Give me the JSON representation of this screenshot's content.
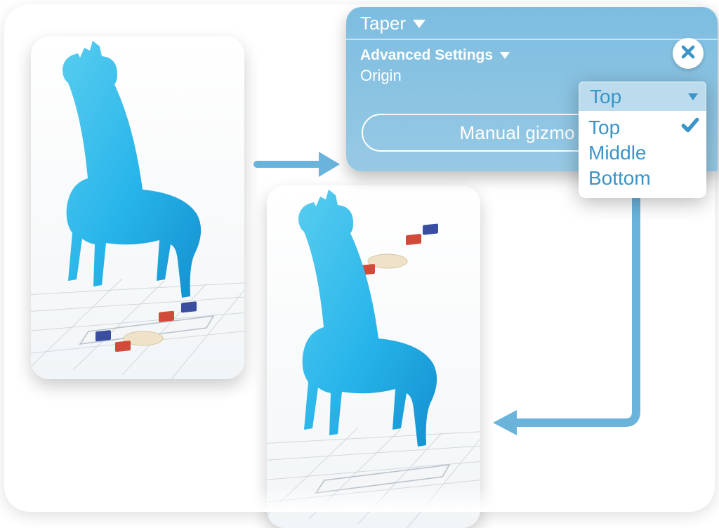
{
  "panel": {
    "title": "Taper",
    "advanced_label": "Advanced Settings",
    "origin_label": "Origin",
    "pill_label": "Manual gizmo po"
  },
  "dropdown": {
    "selected": "Top",
    "options": [
      "Top",
      "Middle",
      "Bottom"
    ],
    "checked_index": 0
  },
  "colors": {
    "accent": "#3a94c8",
    "panel_top": "#7dbde0",
    "panel_bottom": "#97c9e4",
    "giraffe_light": "#4cc6ef",
    "giraffe_dark": "#1c98d6",
    "handle_red": "#d24a3a",
    "handle_blue": "#3a4ea0",
    "arrow": "#6ab4dc",
    "grid": "#d2d8dd"
  }
}
